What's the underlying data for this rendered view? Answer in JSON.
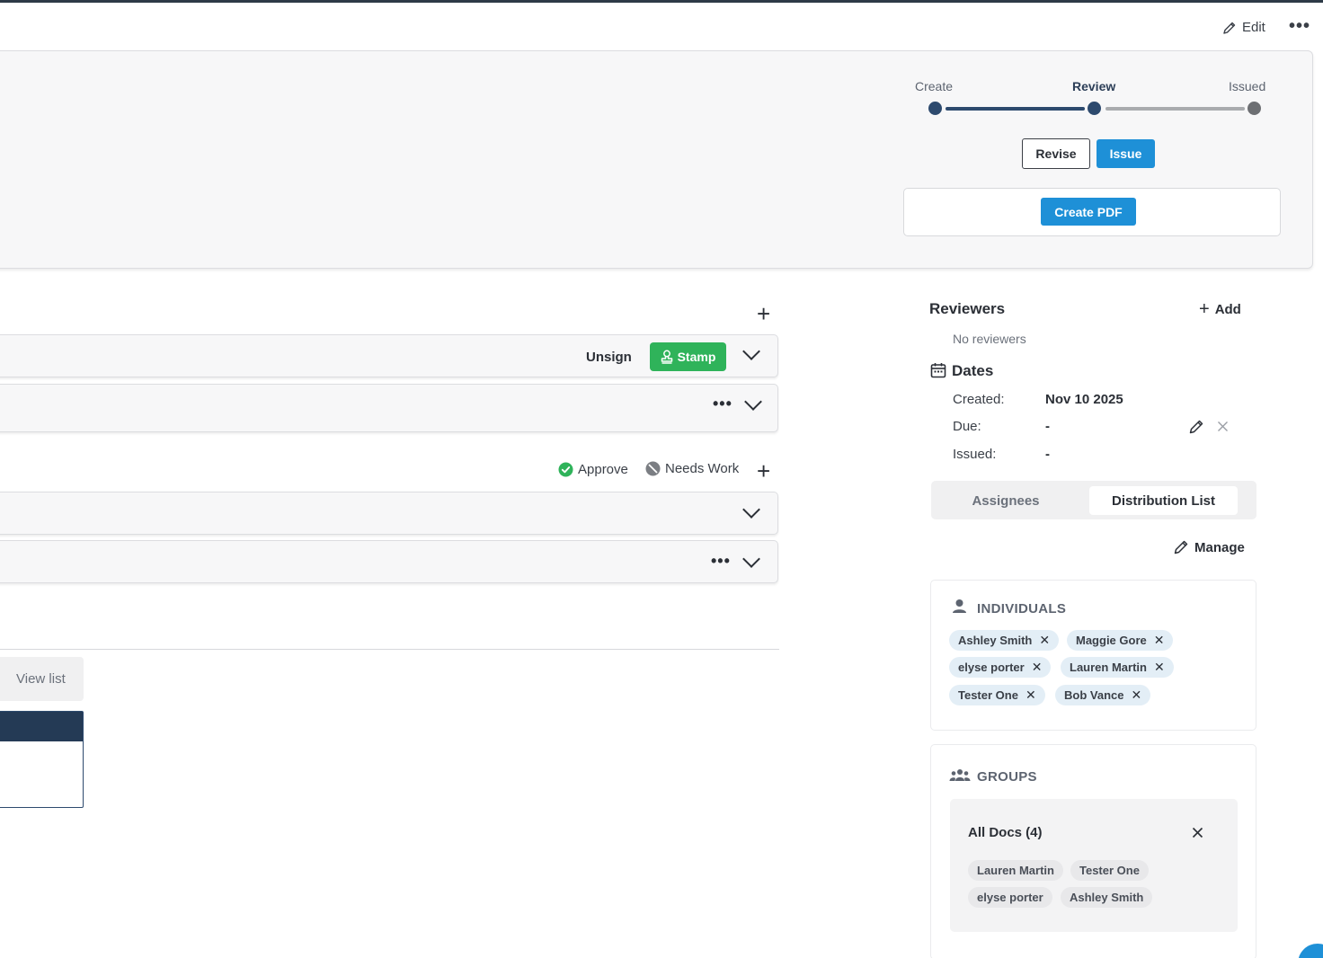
{
  "toolbar": {
    "edit_label": "Edit",
    "more_label": "•••"
  },
  "workflow": {
    "steps": [
      {
        "label": "Create"
      },
      {
        "label": "Review"
      },
      {
        "label": "Issued"
      }
    ],
    "current_step": "Review",
    "revise_label": "Revise",
    "issue_label": "Issue",
    "create_pdf_label": "Create PDF"
  },
  "signatures": {
    "unsign_label": "Unsign",
    "stamp_label": "Stamp",
    "more_label": "•••"
  },
  "responses": {
    "approve_label": "Approve",
    "needs_work_label": "Needs Work",
    "more_label": "•••"
  },
  "view_list_label": "View list",
  "reviewers": {
    "title": "Reviewers",
    "add_label": "Add",
    "empty_text": "No reviewers"
  },
  "dates": {
    "title": "Dates",
    "created_label": "Created:",
    "created_value": "Nov 10 2025",
    "due_label": "Due:",
    "due_value": "-",
    "issued_label": "Issued:",
    "issued_value": "-"
  },
  "tabs": [
    {
      "label": "Assignees",
      "active": false
    },
    {
      "label": "Distribution List",
      "active": true
    }
  ],
  "manage_label": "Manage",
  "individuals": {
    "title": "INDIVIDUALS",
    "people": [
      "Ashley Smith",
      "Maggie Gore",
      "elyse porter",
      "Lauren Martin",
      "Tester One",
      "Bob Vance"
    ]
  },
  "groups": {
    "title": "GROUPS",
    "items": [
      {
        "name": "All Docs (4)",
        "members": [
          "Lauren Martin",
          "Tester One",
          "elyse porter",
          "Ashley Smith"
        ]
      }
    ]
  },
  "colors": {
    "primary": "#1e90d7",
    "stamp": "#2fb35a",
    "navy": "#2d4a6e",
    "chip": "#e3eef6"
  }
}
